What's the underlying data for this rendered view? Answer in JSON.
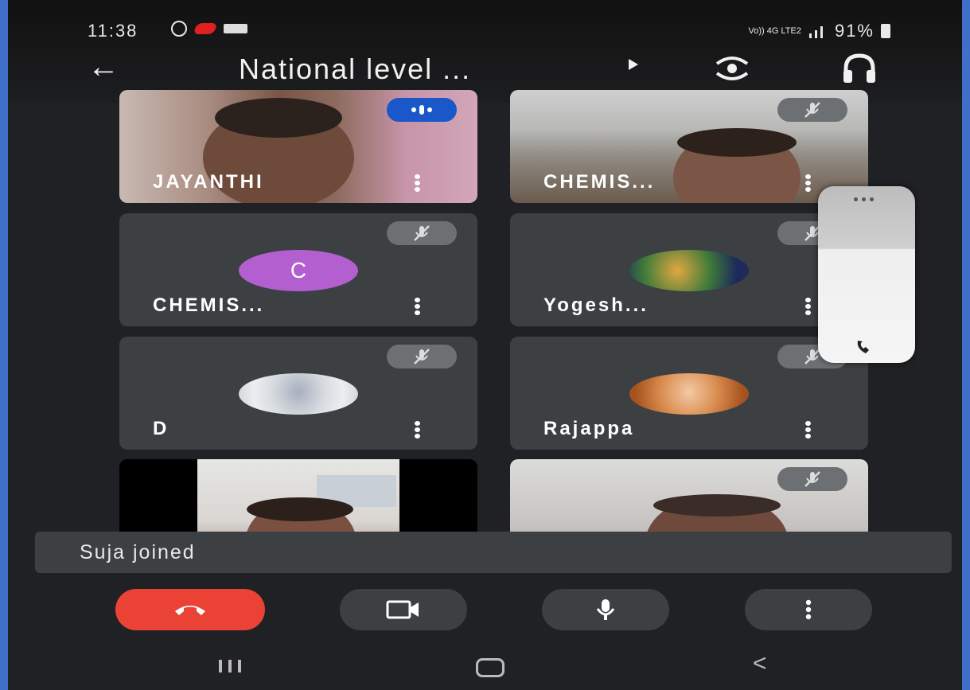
{
  "status_bar": {
    "time": "11:38",
    "network": "Vo)) 4G LTE2",
    "battery": "91%"
  },
  "header": {
    "title": "National level ...",
    "back_icon": "arrow-left-icon",
    "flip_camera_icon": "flip-camera-icon",
    "audio_icon": "headset-icon"
  },
  "participants": [
    {
      "name": "JAYANTHI",
      "type": "video",
      "status": "speaking"
    },
    {
      "name": "CHEMIS...",
      "type": "video",
      "status": "muted"
    },
    {
      "name": "CHEMIS...",
      "type": "avatar",
      "avatar_letter": "C",
      "avatar_color": "#b35fcf",
      "status": "muted"
    },
    {
      "name": "Yogesh...",
      "type": "photo",
      "status": "muted"
    },
    {
      "name": "D",
      "type": "photo",
      "status": "muted"
    },
    {
      "name": "Rajappa",
      "type": "photo",
      "status": "muted"
    },
    {
      "name": "",
      "type": "video",
      "status": ""
    },
    {
      "name": "",
      "type": "video",
      "status": "muted"
    }
  ],
  "notification": {
    "text": "Suja joined"
  },
  "controls": {
    "end_call_color": "#ea4335",
    "buttons": [
      "end-call",
      "camera",
      "microphone",
      "more-options"
    ]
  },
  "nav_bar": {
    "items": [
      "recents",
      "home",
      "back"
    ]
  }
}
